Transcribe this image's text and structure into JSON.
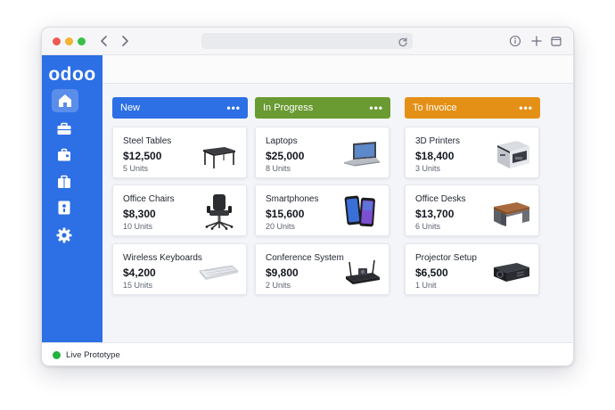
{
  "app": {
    "logo": "odoo",
    "status_text": "Live Prototype"
  },
  "columns": [
    {
      "label": "New",
      "more": "•••",
      "color": "#2d6fe5",
      "cards": [
        {
          "name": "Steel Tables",
          "amount": "$12,500",
          "units": "5 Units",
          "icon": "steel-table-icon"
        },
        {
          "name": "Office Chairs",
          "amount": "$8,300",
          "units": "10 Units",
          "icon": "office-chair-icon"
        },
        {
          "name": "Wireless Keyboards",
          "amount": "$4,200",
          "units": "15 Units",
          "icon": "keyboard-icon"
        }
      ]
    },
    {
      "label": "In Progress",
      "more": "•••",
      "color": "#6a9a32",
      "cards": [
        {
          "name": "Laptops",
          "amount": "$25,000",
          "units": "8 Units",
          "icon": "laptop-icon"
        },
        {
          "name": "Smartphones",
          "amount": "$15,600",
          "units": "20 Units",
          "icon": "smartphone-icon"
        },
        {
          "name": "Conference System",
          "amount": "$9,800",
          "units": "2 Units",
          "icon": "conference-system-icon"
        }
      ]
    },
    {
      "label": "To Invoice",
      "more": "•••",
      "color": "#e49016",
      "cards": [
        {
          "name": "3D Printers",
          "amount": "$18,400",
          "units": "3 Units",
          "icon": "3d-printer-icon"
        },
        {
          "name": "Office Desks",
          "amount": "$13,700",
          "units": "6 Units",
          "icon": "office-desk-icon"
        },
        {
          "name": "Projector Setup",
          "amount": "$6,500",
          "units": "1 Unit",
          "icon": "projector-icon"
        }
      ]
    }
  ],
  "sidebar": {
    "items": [
      {
        "icon": "home-icon",
        "active": true
      },
      {
        "icon": "briefcase-icon"
      },
      {
        "icon": "suitcase-icon"
      },
      {
        "icon": "bag-icon"
      },
      {
        "icon": "contacts-icon"
      },
      {
        "icon": "settings-icon"
      }
    ]
  },
  "colors": {
    "status_green": "#22b33f",
    "sidebar_blue": "#2d6fe5"
  }
}
